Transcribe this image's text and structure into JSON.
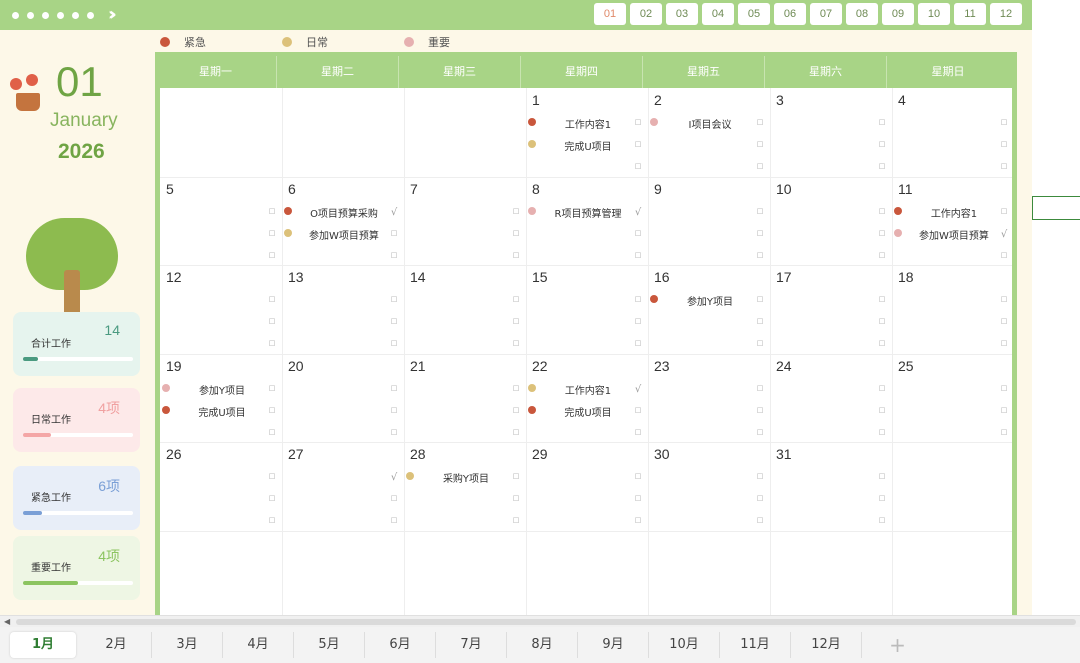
{
  "header": {
    "month_buttons": [
      "01",
      "02",
      "03",
      "04",
      "05",
      "06",
      "07",
      "08",
      "09",
      "10",
      "11",
      "12"
    ],
    "active_month_index": 0
  },
  "legend": [
    {
      "label": "紧急",
      "color": "#c9573c"
    },
    {
      "label": "日常",
      "color": "#dcc17a"
    },
    {
      "label": "重要",
      "color": "#e6b0b0"
    }
  ],
  "sidebar": {
    "month_number": "01",
    "month_name": "January",
    "year": "2026",
    "cards": [
      {
        "label": "合计工作",
        "value": "14",
        "bg": "#e6f4ee",
        "color": "#4a9a80",
        "fill": "#4a9a80",
        "fraction": 0.14
      },
      {
        "label": "日常工作",
        "value": "4项",
        "bg": "#fde9e9",
        "color": "#f0a0a0",
        "fill": "#f4a6a6",
        "fraction": 0.25
      },
      {
        "label": "紧急工作",
        "value": "6项",
        "bg": "#e8eef8",
        "color": "#7a9fd6",
        "fill": "#7a9fd6",
        "fraction": 0.17
      },
      {
        "label": "重要工作",
        "value": "4项",
        "bg": "#eef6e4",
        "color": "#8cc460",
        "fill": "#8cc460",
        "fraction": 0.5
      }
    ]
  },
  "weekdays": [
    "星期一",
    "星期二",
    "星期三",
    "星期四",
    "星期五",
    "星期六",
    "星期日"
  ],
  "days": [
    {
      "day": "1",
      "row": 0,
      "col": 3
    },
    {
      "day": "2",
      "row": 0,
      "col": 4
    },
    {
      "day": "3",
      "row": 0,
      "col": 5
    },
    {
      "day": "4",
      "row": 0,
      "col": 6
    },
    {
      "day": "5",
      "row": 1,
      "col": 0
    },
    {
      "day": "6",
      "row": 1,
      "col": 1
    },
    {
      "day": "7",
      "row": 1,
      "col": 2
    },
    {
      "day": "8",
      "row": 1,
      "col": 3
    },
    {
      "day": "9",
      "row": 1,
      "col": 4
    },
    {
      "day": "10",
      "row": 1,
      "col": 5
    },
    {
      "day": "11",
      "row": 1,
      "col": 6
    },
    {
      "day": "12",
      "row": 2,
      "col": 0
    },
    {
      "day": "13",
      "row": 2,
      "col": 1
    },
    {
      "day": "14",
      "row": 2,
      "col": 2
    },
    {
      "day": "15",
      "row": 2,
      "col": 3
    },
    {
      "day": "16",
      "row": 2,
      "col": 4
    },
    {
      "day": "17",
      "row": 2,
      "col": 5
    },
    {
      "day": "18",
      "row": 2,
      "col": 6
    },
    {
      "day": "19",
      "row": 3,
      "col": 0
    },
    {
      "day": "20",
      "row": 3,
      "col": 1
    },
    {
      "day": "21",
      "row": 3,
      "col": 2
    },
    {
      "day": "22",
      "row": 3,
      "col": 3
    },
    {
      "day": "23",
      "row": 3,
      "col": 4
    },
    {
      "day": "24",
      "row": 3,
      "col": 5
    },
    {
      "day": "25",
      "row": 3,
      "col": 6
    },
    {
      "day": "26",
      "row": 4,
      "col": 0
    },
    {
      "day": "27",
      "row": 4,
      "col": 1
    },
    {
      "day": "28",
      "row": 4,
      "col": 2
    },
    {
      "day": "29",
      "row": 4,
      "col": 3
    },
    {
      "day": "30",
      "row": 4,
      "col": 4
    },
    {
      "day": "31",
      "row": 4,
      "col": 5
    }
  ],
  "events": [
    {
      "text": "工作内容1",
      "color": "#c9573c",
      "row": 0,
      "col": 3,
      "slot": 0
    },
    {
      "text": "完成U项目",
      "color": "#dcc17a",
      "row": 0,
      "col": 3,
      "slot": 1
    },
    {
      "text": "I项目会议",
      "color": "#e6b0b0",
      "row": 0,
      "col": 4,
      "slot": 0
    },
    {
      "text": "O项目预算采购",
      "color": "#c9573c",
      "row": 1,
      "col": 1,
      "slot": 0
    },
    {
      "text": "参加W项目预算",
      "color": "#dcc17a",
      "row": 1,
      "col": 1,
      "slot": 1
    },
    {
      "text": "R项目预算管理",
      "color": "#e6b0b0",
      "row": 1,
      "col": 3,
      "slot": 0
    },
    {
      "text": "工作内容1",
      "color": "#c9573c",
      "row": 1,
      "col": 6,
      "slot": 0
    },
    {
      "text": "参加W项目预算",
      "color": "#e6b0b0",
      "row": 1,
      "col": 6,
      "slot": 1
    },
    {
      "text": "参加Y项目",
      "color": "#c9573c",
      "row": 2,
      "col": 4,
      "slot": 0
    },
    {
      "text": "参加Y项目",
      "color": "#e6b0b0",
      "row": 3,
      "col": 0,
      "slot": 0
    },
    {
      "text": "完成U项目",
      "color": "#c9573c",
      "row": 3,
      "col": 0,
      "slot": 1
    },
    {
      "text": "工作内容1",
      "color": "#dcc17a",
      "row": 3,
      "col": 3,
      "slot": 0
    },
    {
      "text": "完成U项目",
      "color": "#c9573c",
      "row": 3,
      "col": 3,
      "slot": 1
    },
    {
      "text": "采购Y项目",
      "color": "#dcc17a",
      "row": 4,
      "col": 2,
      "slot": 0
    }
  ],
  "checks": [
    {
      "row": 1,
      "col": 1,
      "slot": 0
    },
    {
      "row": 1,
      "col": 3,
      "slot": 0
    },
    {
      "row": 1,
      "col": 6,
      "slot": 1
    },
    {
      "row": 3,
      "col": 3,
      "slot": 0
    },
    {
      "row": 4,
      "col": 1,
      "slot": 0
    }
  ],
  "sheet_tabs": [
    "1月",
    "2月",
    "3月",
    "4月",
    "5月",
    "6月",
    "7月",
    "8月",
    "9月",
    "10月",
    "11月",
    "12月"
  ],
  "active_tab_index": 0,
  "add_tab_label": "+"
}
